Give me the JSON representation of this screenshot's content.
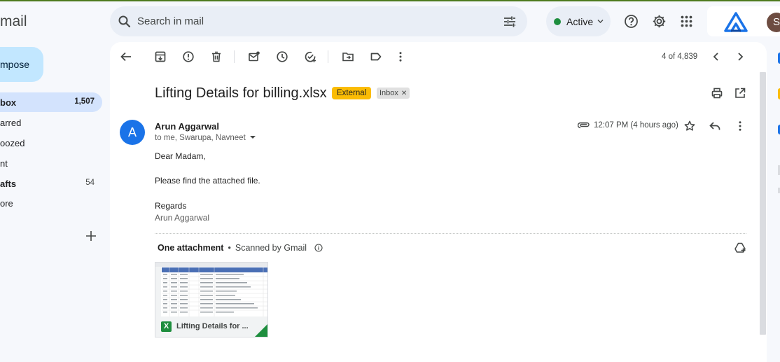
{
  "app": {
    "brand": "mail"
  },
  "sidebar": {
    "compose_label": "mpose",
    "items": [
      {
        "label": "box",
        "count": "1,507"
      },
      {
        "label": "arred",
        "count": ""
      },
      {
        "label": "oozed",
        "count": ""
      },
      {
        "label": "nt",
        "count": ""
      },
      {
        "label": "afts",
        "count": "54"
      },
      {
        "label": "ore",
        "count": ""
      }
    ]
  },
  "search": {
    "placeholder": "Search in mail"
  },
  "status": {
    "label": "Active",
    "color": "#1e8e3e"
  },
  "account": {
    "avatar_letter": "S"
  },
  "toolbar": {
    "pager": "4 of 4,839"
  },
  "email": {
    "subject": "Lifting Details for billing.xlsx",
    "labels": {
      "external": "External",
      "inbox": "Inbox"
    },
    "sender_initial": "A",
    "sender": "Arun Aggarwal",
    "recipients": "to me, Swarupa, Navneet",
    "time": "12:07 PM (4 hours ago)",
    "body": {
      "greeting": "Dear Madam,",
      "line1": "Please find the attached file.",
      "closing": "Regards",
      "signature": "Arun Aggarwal"
    }
  },
  "attachments": {
    "heading": "One attachment",
    "scanned": "Scanned by Gmail",
    "file_label": "Lifting Details for ...",
    "file_type_letter": "X"
  },
  "colors": {
    "external_tag": "#fbbc04",
    "excel_green": "#1e8e3e",
    "sender_avatar": "#1a73e8"
  }
}
